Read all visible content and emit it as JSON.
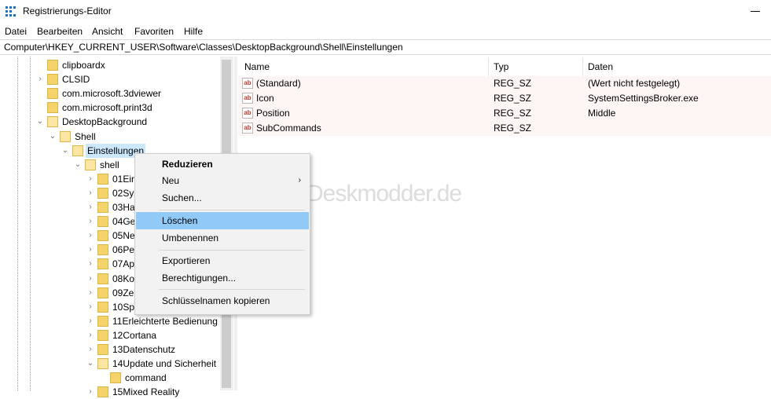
{
  "window": {
    "title": "Registrierungs-Editor"
  },
  "menu": [
    "Datei",
    "Bearbeiten",
    "Ansicht",
    "Favoriten",
    "Hilfe"
  ],
  "address": "Computer\\HKEY_CURRENT_USER\\Software\\Classes\\DesktopBackground\\Shell\\Einstellungen",
  "tree": [
    {
      "label": "clipboardx",
      "chev": ""
    },
    {
      "label": "CLSID",
      "chev": "›"
    },
    {
      "label": "com.microsoft.3dviewer",
      "chev": ""
    },
    {
      "label": "com.microsoft.print3d",
      "chev": ""
    },
    {
      "label": "DesktopBackground",
      "chev": "⌄"
    },
    {
      "label": "Shell",
      "chev": "⌄"
    },
    {
      "label": "Einstellungen",
      "chev": "⌄"
    },
    {
      "label": "shell",
      "chev": "⌄"
    },
    {
      "label": "01Ein",
      "chev": "›"
    },
    {
      "label": "02Sys",
      "chev": "›"
    },
    {
      "label": "03Ha",
      "chev": "›"
    },
    {
      "label": "04Ge",
      "chev": "›"
    },
    {
      "label": "05Ne",
      "chev": "›"
    },
    {
      "label": "06Per",
      "chev": "›"
    },
    {
      "label": "07Ap",
      "chev": "›"
    },
    {
      "label": "08Ko",
      "chev": "›"
    },
    {
      "label": "09Zei",
      "chev": "›"
    },
    {
      "label": "10Spi",
      "chev": "›"
    },
    {
      "label": "11Erleichterte Bedienung",
      "chev": "›"
    },
    {
      "label": "12Cortana",
      "chev": "›"
    },
    {
      "label": "13Datenschutz",
      "chev": "›"
    },
    {
      "label": "14Update und Sicherheit",
      "chev": "⌄"
    },
    {
      "label": "command",
      "chev": ""
    },
    {
      "label": "15Mixed Reality",
      "chev": "›"
    }
  ],
  "list": {
    "columns": [
      "Name",
      "Typ",
      "Daten"
    ],
    "rows": [
      {
        "name": "(Standard)",
        "type": "REG_SZ",
        "data": "(Wert nicht festgelegt)"
      },
      {
        "name": "Icon",
        "type": "REG_SZ",
        "data": "SystemSettingsBroker.exe"
      },
      {
        "name": "Position",
        "type": "REG_SZ",
        "data": "Middle"
      },
      {
        "name": "SubCommands",
        "type": "REG_SZ",
        "data": ""
      }
    ],
    "icon_glyph": "ab"
  },
  "watermark": "Deskmodder.de",
  "context_menu": [
    {
      "label": "Reduzieren"
    },
    {
      "label": "Neu",
      "submenu": "›"
    },
    {
      "label": "Suchen..."
    },
    {
      "label": "Löschen"
    },
    {
      "label": "Umbenennen"
    },
    {
      "label": "Exportieren"
    },
    {
      "label": "Berechtigungen..."
    },
    {
      "label": "Schlüsselnamen kopieren"
    }
  ],
  "colors": {
    "selection": "#cce8ff",
    "menu_highlight": "#91c9f7",
    "folder": "#f5d36b"
  }
}
